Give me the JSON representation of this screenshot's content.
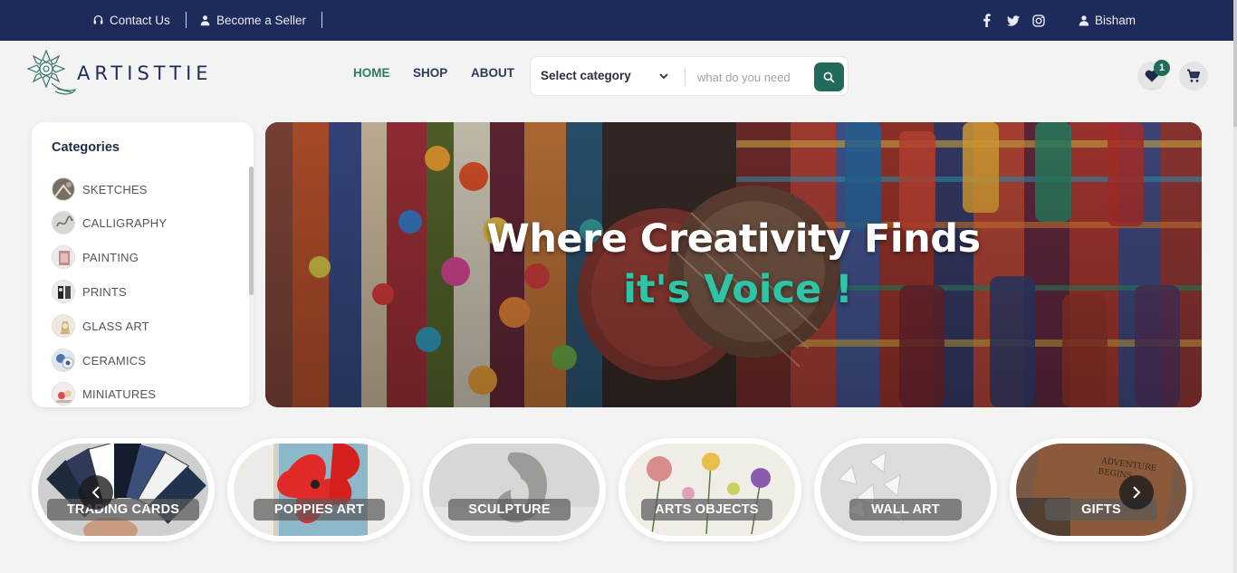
{
  "topbar": {
    "contact_label": "Contact Us",
    "seller_label": "Become a Seller",
    "user_name": "Bisham",
    "social": [
      "facebook-icon",
      "twitter-icon",
      "instagram-icon"
    ]
  },
  "brand": {
    "name": "ARTISTTIE",
    "color": "#1f2d57"
  },
  "nav": {
    "home": "HOME",
    "shop": "SHOP",
    "about": "ABOUT"
  },
  "search": {
    "category": "Select category",
    "placeholder": "what do you need"
  },
  "wishlist": {
    "count": "1"
  },
  "categories": {
    "title": "Categories",
    "items": [
      {
        "label": "SKETCHES"
      },
      {
        "label": "CALLIGRAPHY"
      },
      {
        "label": "PAINTING"
      },
      {
        "label": "PRINTS"
      },
      {
        "label": "GLASS ART"
      },
      {
        "label": "CERAMICS"
      },
      {
        "label": "MINIATURES"
      }
    ]
  },
  "hero": {
    "line1": "Where Creativity Finds",
    "line2": "it's Voice !",
    "accent": "#2ec4a6"
  },
  "carousel": {
    "items": [
      {
        "label": "TRADING CARDS"
      },
      {
        "label": "POPPIES ART"
      },
      {
        "label": "SCULPTURE"
      },
      {
        "label": "ARTS OBJECTS"
      },
      {
        "label": "WALL ART"
      },
      {
        "label": "GIFTS"
      }
    ]
  },
  "colors": {
    "topbar": "#1e2a5a",
    "primary": "#226a5a"
  }
}
